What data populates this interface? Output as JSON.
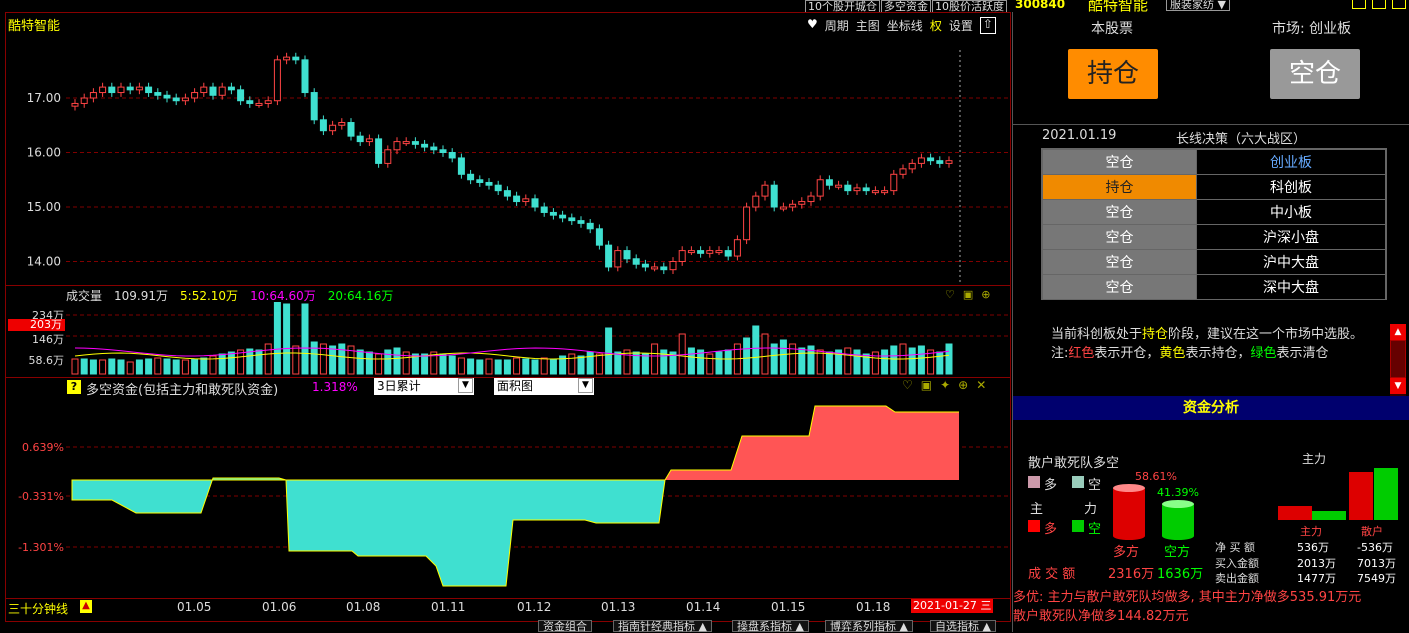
{
  "app": {
    "stock_name": "酷特智能",
    "stock_code": "300840",
    "brand": "酷特智能",
    "industry": "服装家纺 ▼"
  },
  "topbar": [
    "10个股开城仓",
    "多空资金",
    "10股价活跃度"
  ],
  "toolbar": {
    "period": "周期",
    "main": "主图",
    "coord": "坐标线",
    "quan": "权",
    "settings": "设置"
  },
  "price_axis": [
    "17.00",
    "16.00",
    "15.00",
    "14.00"
  ],
  "volume": {
    "label": "成交量",
    "value": "109.91万",
    "ma5": "5:52.10万",
    "ma10": "10:64.60万",
    "ma20": "20:64.16万",
    "axis": [
      "234万",
      "203万",
      "146万",
      "58.6万"
    ],
    "marker": "203万"
  },
  "indicator": {
    "help": "?",
    "title": "多空资金(包括主力和敢死队资金)",
    "value": "1.318%",
    "select1": "3日累计",
    "select2": "面积图",
    "axis": [
      "0.639%",
      "-0.331%",
      "-1.301%"
    ]
  },
  "bottom": {
    "period_label": "三十分钟线",
    "warn": "▲",
    "dates": [
      "01.05",
      "01.06",
      "01.08",
      "01.11",
      "01.12",
      "01.13",
      "01.14",
      "01.15",
      "01.18"
    ],
    "current_date": "2021-01-27 三"
  },
  "tabs": [
    "资金组合",
    "指南针经典指标 ▲",
    "操盘系指标 ▲",
    "博弈系列指标 ▲",
    "自选指标 ▲"
  ],
  "right": {
    "stock_label": "本股票",
    "market_label": "市场: 创业板",
    "hold": "持仓",
    "empty": "空仓",
    "date": "2021.01.19",
    "strategy": "长线决策（六大战区）",
    "zones": [
      {
        "state": "空仓",
        "name": "创业板",
        "active": false,
        "highlight": true
      },
      {
        "state": "持仓",
        "name": "科创板",
        "active": true,
        "highlight": false
      },
      {
        "state": "空仓",
        "name": "中小板",
        "active": false,
        "highlight": false
      },
      {
        "state": "空仓",
        "name": "沪深小盘",
        "active": false,
        "highlight": false
      },
      {
        "state": "空仓",
        "name": "沪中大盘",
        "active": false,
        "highlight": false
      },
      {
        "state": "空仓",
        "name": "深中大盘",
        "active": false,
        "highlight": false
      }
    ],
    "advice_1": "当前科创板处于",
    "advice_hold": "持仓",
    "advice_2": "阶段，建议在这一个市场中选股。",
    "note_prefix": "注:",
    "note_red": "红色",
    "note_r": "表示开仓，",
    "note_yellow": "黄色",
    "note_y": "表示持仓，",
    "note_green": "绿色",
    "note_g": "表示清仓",
    "fund_title": "资金分析",
    "retail_title": "散户敢死队多空",
    "long_pct": "58.61%",
    "short_pct": "41.39%",
    "leg_duo": "多",
    "leg_kong": "空",
    "leg_zhu": "主",
    "leg_li": "力",
    "long_label": "多方",
    "short_label": "空方",
    "vol_label": "成 交 额",
    "long_vol": "2316万",
    "short_vol": "1636万",
    "main_title": "主力",
    "col_main": "主力",
    "col_retail": "散户",
    "rows": [
      {
        "label": "净 买 额",
        "main": "536万",
        "retail": "-536万"
      },
      {
        "label": "买入金额",
        "main": "2013万",
        "retail": "7013万"
      },
      {
        "label": "卖出金额",
        "main": "1477万",
        "retail": "7549万"
      }
    ],
    "summary1": "多优: 主力与散户敢死队均做多, 其中主力净做多535.91万元",
    "summary2": "散户敢死队净做多144.82万元"
  },
  "colors": {
    "up": "#ff4444",
    "down": "#3fe0d0",
    "accent_yellow": "#ffff00",
    "grid": "#800000"
  }
}
